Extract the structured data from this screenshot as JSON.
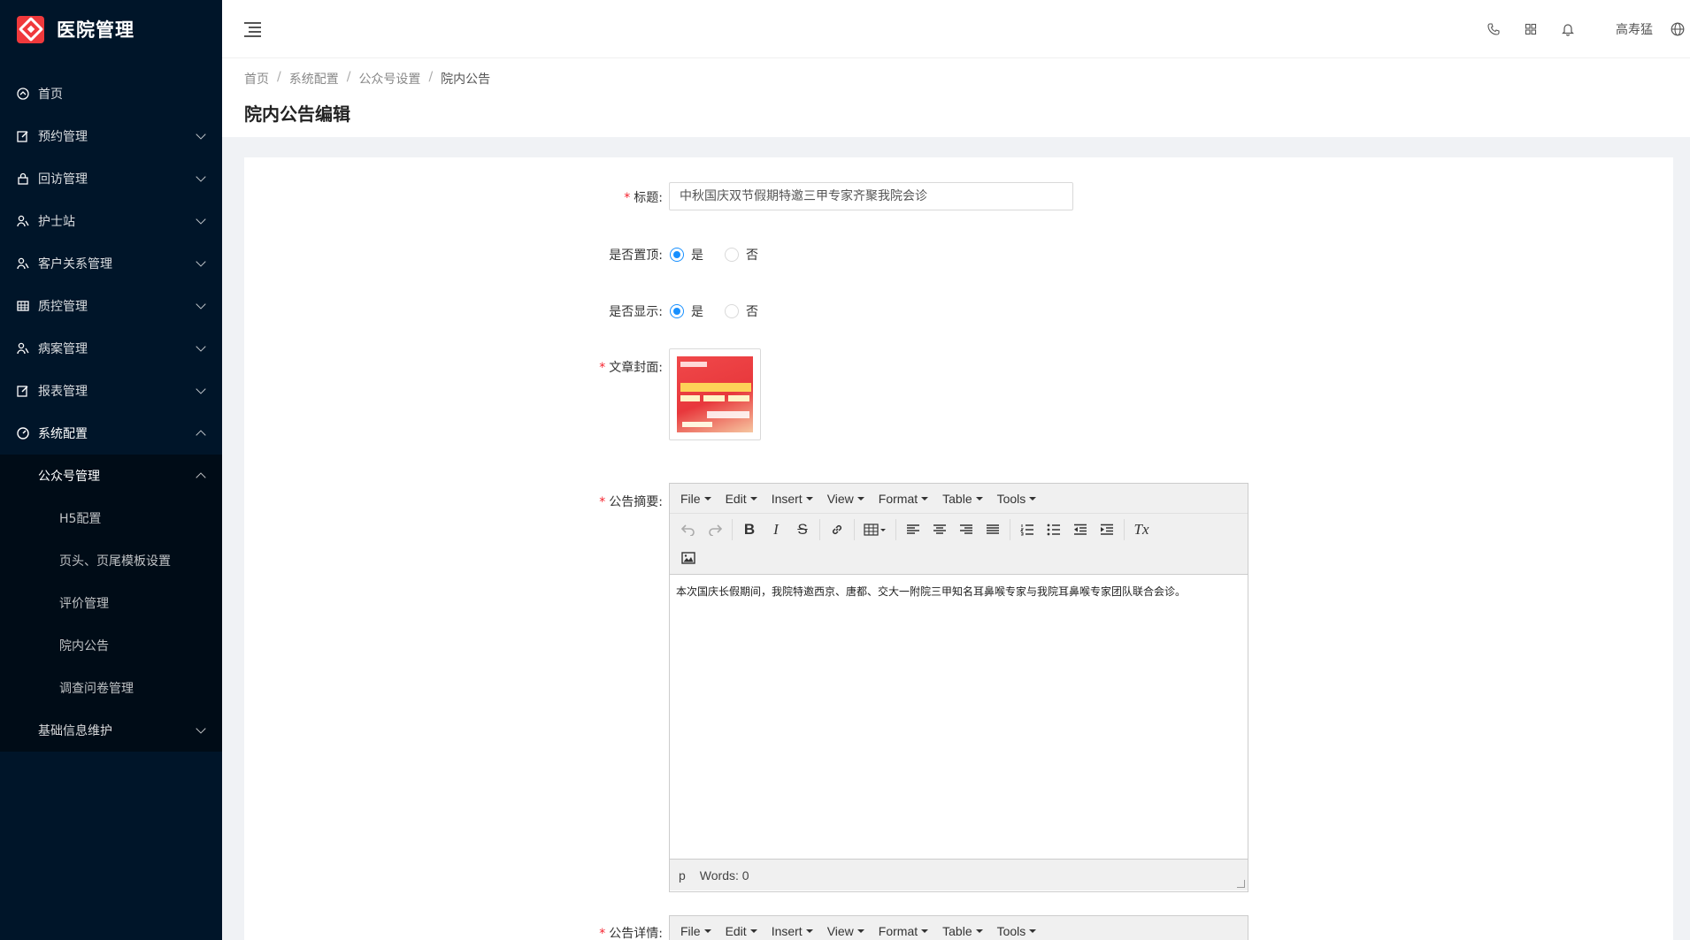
{
  "app": {
    "title": "医院管理"
  },
  "sidebar": {
    "items": [
      {
        "label": "首页",
        "icon": "dashboard-icon",
        "has_arrow": false
      },
      {
        "label": "预约管理",
        "icon": "edit-icon",
        "has_arrow": true
      },
      {
        "label": "回访管理",
        "icon": "lock-icon",
        "has_arrow": true
      },
      {
        "label": "护士站",
        "icon": "users-icon",
        "has_arrow": true
      },
      {
        "label": "客户关系管理",
        "icon": "users-icon",
        "has_arrow": true
      },
      {
        "label": "质控管理",
        "icon": "table-icon",
        "has_arrow": true
      },
      {
        "label": "病案管理",
        "icon": "users-icon",
        "has_arrow": true
      },
      {
        "label": "报表管理",
        "icon": "edit-icon",
        "has_arrow": true
      },
      {
        "label": "系统配置",
        "icon": "gauge-icon",
        "has_arrow": true
      }
    ],
    "submenu": {
      "parent": "公众号管理",
      "children": [
        "H5配置",
        "页头、页尾模板设置",
        "评价管理",
        "院内公告",
        "调查问卷管理"
      ],
      "other": "基础信息维护"
    }
  },
  "header": {
    "username": "高寿猛",
    "icons": [
      "phone-icon",
      "grid-icon",
      "bell-icon",
      "globe-icon"
    ]
  },
  "breadcrumb": [
    "首页",
    "系统配置",
    "公众号设置",
    "院内公告"
  ],
  "page": {
    "title": "院内公告编辑"
  },
  "form": {
    "title_label": "标题:",
    "title_value": "中秋国庆双节假期特邀三甲专家齐聚我院会诊",
    "pin_label": "是否置顶:",
    "show_label": "是否显示:",
    "radio_yes": "是",
    "radio_no": "否",
    "pin_value": "是",
    "show_value": "是",
    "cover_label": "文章封面:",
    "summary_label": "公告摘要:",
    "detail_label": "公告详情:"
  },
  "editor": {
    "menus": [
      "File",
      "Edit",
      "Insert",
      "View",
      "Format",
      "Table",
      "Tools"
    ],
    "summary_content": "本次国庆长假期间，我院特邀西京、唐都、交大一附院三甲知名耳鼻喉专家与我院耳鼻喉专家团队联合会诊。",
    "status_path": "p",
    "status_words": "Words: 0",
    "toolbar_glyphs": {
      "bold": "B",
      "italic": "I",
      "strike": "S",
      "clear": "Tx"
    }
  }
}
